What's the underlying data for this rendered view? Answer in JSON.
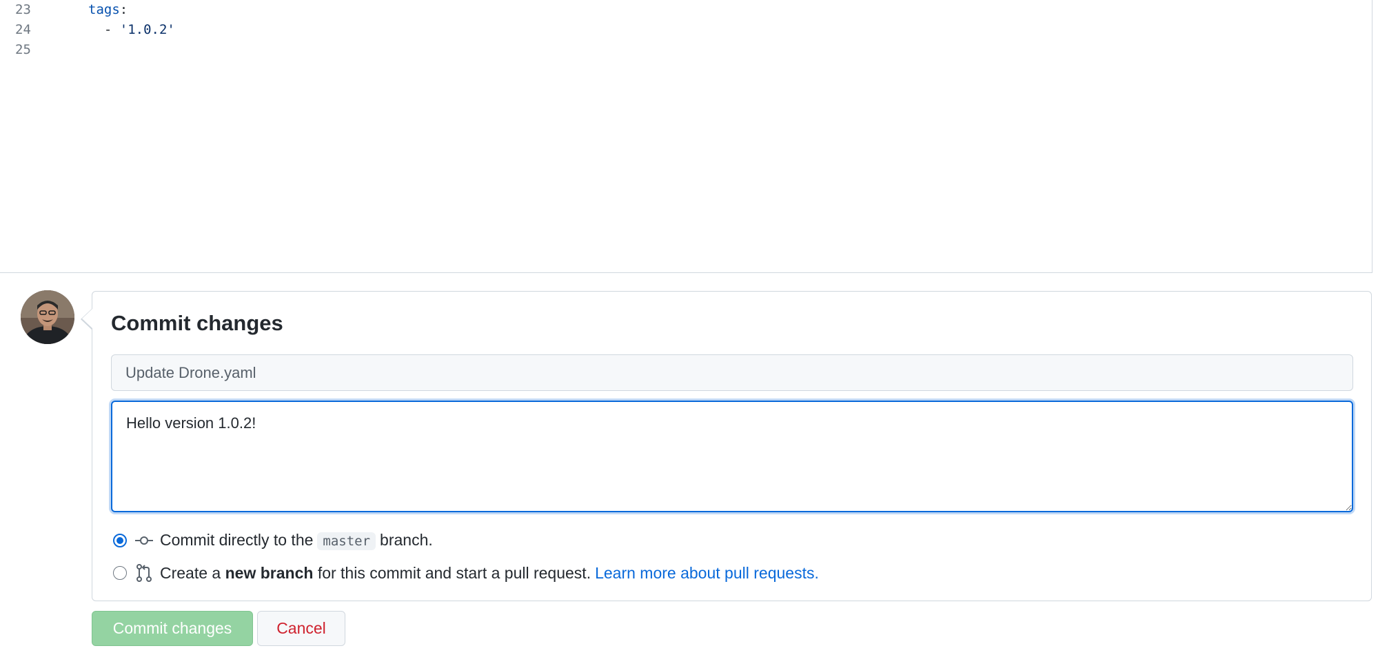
{
  "editor": {
    "lines": [
      {
        "num": "23",
        "key": "tags",
        "punct": ":",
        "value": ""
      },
      {
        "num": "24",
        "key": "",
        "punct": "  - ",
        "value": "'1.0.2'"
      },
      {
        "num": "25",
        "key": "",
        "punct": "",
        "value": ""
      }
    ]
  },
  "commit": {
    "title": "Commit changes",
    "summary_placeholder": "Update Drone.yaml",
    "summary_value": "",
    "description_value": "Hello version 1.0.2!",
    "option_direct": {
      "prefix": "Commit directly to the",
      "branch": "master",
      "suffix": "branch.",
      "selected": true
    },
    "option_new_branch": {
      "prefix": "Create a",
      "bold": "new branch",
      "suffix": "for this commit and start a pull request.",
      "link": "Learn more about pull requests.",
      "selected": false
    }
  },
  "actions": {
    "commit_label": "Commit changes",
    "cancel_label": "Cancel"
  },
  "colors": {
    "accent": "#0969da",
    "commit_button": "#94d3a2",
    "cancel_text": "#cf222e"
  },
  "icons": {
    "avatar": "user-avatar",
    "commit": "git-commit-icon",
    "pull_request": "git-pull-request-icon"
  }
}
